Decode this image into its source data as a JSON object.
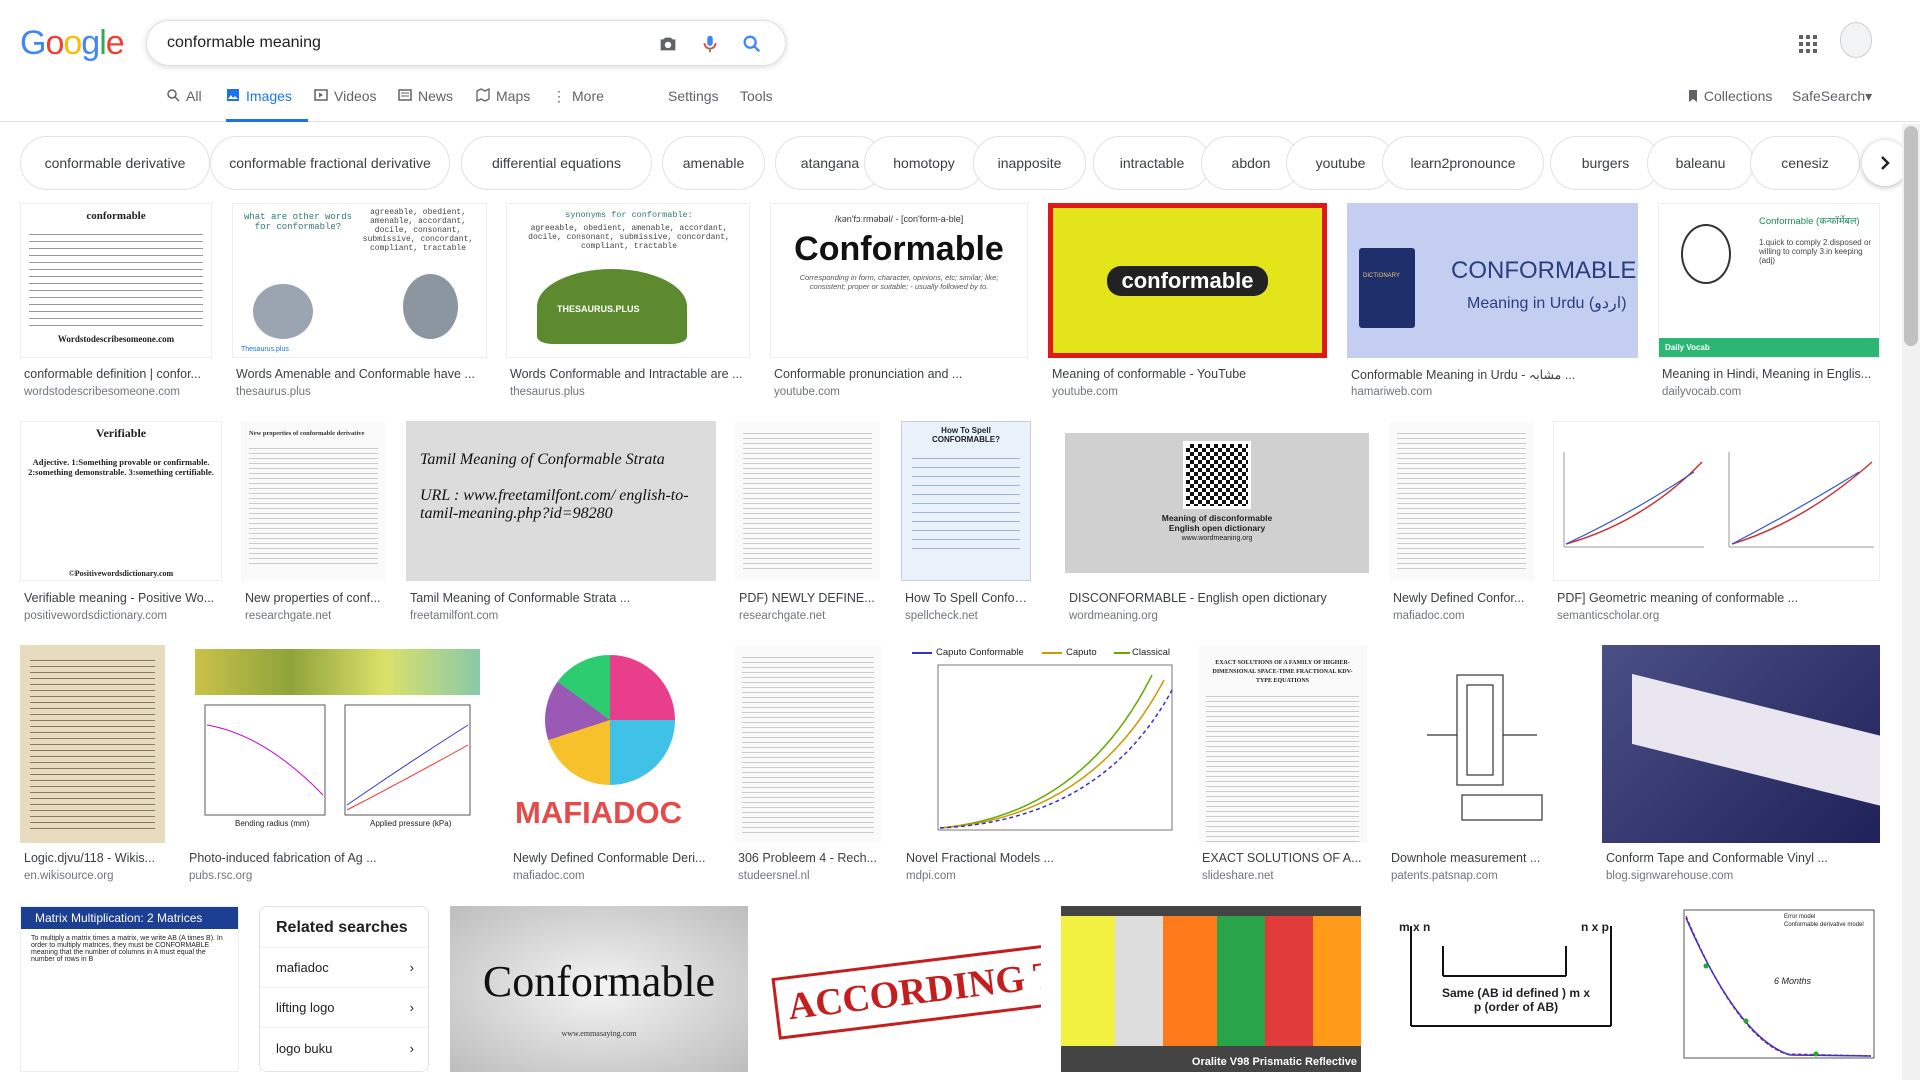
{
  "header": {
    "logo_letters": [
      "G",
      "o",
      "o",
      "g",
      "l",
      "e"
    ],
    "logo_colors": [
      "#4285F4",
      "#EA4335",
      "#FBBC05",
      "#4285F4",
      "#34A853",
      "#EA4335"
    ],
    "search_query": "conformable meaning"
  },
  "tabs": [
    {
      "label": "All",
      "icon": "search-icon"
    },
    {
      "label": "Images",
      "icon": "image-icon",
      "active": true
    },
    {
      "label": "Videos",
      "icon": "video-icon"
    },
    {
      "label": "News",
      "icon": "news-icon"
    },
    {
      "label": "Maps",
      "icon": "map-icon"
    },
    {
      "label": "More",
      "icon": "more-dots-icon"
    },
    {
      "label": "Settings"
    },
    {
      "label": "Tools"
    }
  ],
  "right_tools": {
    "collections": "Collections",
    "safesearch": "SafeSearch"
  },
  "chips": [
    "conformable derivative",
    "conformable fractional derivative",
    "differential equations",
    "amenable",
    "atangana",
    "homotopy",
    "inapposite",
    "intractable",
    "abdon",
    "youtube",
    "learn2pronounce",
    "burgers",
    "baleanu",
    "cenesiz"
  ],
  "results": [
    {
      "caption": "conformable definition | confor...",
      "source": "wordstodescribesomeone.com",
      "img_text": "conformable",
      "img_foot": "Wordstodescribesomeone.com"
    },
    {
      "caption": "Words Amenable and Conformable have ...",
      "source": "thesaurus.plus",
      "img_text": "what are other words for conformable?",
      "img_text2": "agreeable, obedient, amenable, accordant, docile, consonant, submissive, concordant, compliant, tractable",
      "img_foot": "Thesaurus.plus"
    },
    {
      "caption": "Words Conformable and Intractable are ...",
      "source": "thesaurus.plus",
      "img_text": "synonyms for conformable:",
      "img_text2": "agreeable, obedient, amenable, accordant, docile, consonant, submissive, concordant, compliant, tractable",
      "img_foot": "THESAURUS.PLUS"
    },
    {
      "caption": "Conformable pronunciation and ...",
      "source": "youtube.com",
      "img_text": "Conformable",
      "img_text2": "/kən'fɔːrməbəl/ - [con'form-a-ble]",
      "img_foot": "Corresponding in form, character, opinions, etc; similar; like; consistent; proper or suitable; - usually followed by to."
    },
    {
      "caption": "Meaning of conformable - YouTube",
      "source": "youtube.com",
      "img_text": "conformable"
    },
    {
      "caption": "Conformable Meaning in Urdu - مشابہ ...",
      "source": "hamariweb.com",
      "img_text": "CONFORMABLE",
      "img_text2": "Meaning in Urdu (اردو)",
      "img_foot": "DICTIONARY"
    },
    {
      "caption": "Meaning in Hindi, Meaning in Englis...",
      "source": "dailyvocab.com",
      "img_text": "Conformable (कन्फॉर्मेबल)",
      "img_text2": "1.quick to comply 2.disposed or willing to comply 3.in keeping (adj)",
      "img_foot": "Daily Vocab"
    },
    {
      "caption": "Verifiable meaning - Positive Wo...",
      "source": "positivewordsdictionary.com",
      "img_text": "Verifiable",
      "img_text2": "Adjective. 1:Something provable or confirmable. 2:something demonstrable. 3:something certifiable.",
      "img_foot": "©Positivewordsdictionary.com"
    },
    {
      "caption": "New properties of conf...",
      "source": "researchgate.net",
      "img_text": "New properties of conformable derivative"
    },
    {
      "caption": "Tamil Meaning of Conformable Strata ...",
      "source": "freetamilfont.com",
      "img_text": "Tamil Meaning of Conformable Strata",
      "img_text2": "URL : www.freetamilfont.com/ english-to-tamil-meaning.php?id=98280"
    },
    {
      "caption": "PDF) NEWLY DEFINE...",
      "source": "researchgate.net"
    },
    {
      "caption": "How To Spell Conform...",
      "source": "spellcheck.net",
      "img_text": "How To Spell CONFORMABLE?"
    },
    {
      "caption": "DISCONFORMABLE - English open dictionary",
      "source": "wordmeaning.org",
      "img_text": "Meaning of disconformable English open dictionary",
      "img_foot": "www.wordmeaning.org"
    },
    {
      "caption": "Newly Defined Confor...",
      "source": "mafiadoc.com"
    },
    {
      "caption": "PDF] Geometric meaning of conformable ...",
      "source": "semanticscholar.org"
    },
    {
      "caption": "Logic.djvu/118 - Wikis...",
      "source": "en.wikisource.org"
    },
    {
      "caption": "Photo-induced fabrication of Ag ...",
      "source": "pubs.rsc.org",
      "img_text": "Bending radius (mm)",
      "img_text2": "Applied pressure (kPa)"
    },
    {
      "caption": "Newly Defined Conformable Deri...",
      "source": "mafiadoc.com",
      "img_text": "MAFIADOC"
    },
    {
      "caption": "306 Probleem 4 - Rech...",
      "source": "studeersnel.nl"
    },
    {
      "caption": "Novel Fractional Models ...",
      "source": "mdpi.com",
      "img_text": "Caputo Conformable",
      "img_text2": "Caputo",
      "img_foot": "Classical"
    },
    {
      "caption": "EXACT SOLUTIONS OF A...",
      "source": "slideshare.net",
      "img_text": "EXACT SOLUTIONS OF A FAMILY OF HIGHER-DIMENSIONAL SPACE-TIME FRACTIONAL KDV-TYPE EQUATIONS"
    },
    {
      "caption": "Downhole measurement ...",
      "source": "patents.patsnap.com"
    },
    {
      "caption": "Conform Tape and Conformable Vinyl ...",
      "source": "blog.signwarehouse.com"
    },
    {
      "img_text": "Matrix Multiplication: 2 Matrices",
      "img_text2": "To multiply a matrix times a matrix, we write AB (A times B). In order to multiply matrices, they must be CONFORMABLE meaning that the number of columns in A must equal the number of rows in B"
    },
    {
      "img_text": "Conformable",
      "img_foot": "www.emmasaying.com"
    },
    {
      "img_text": "ACCORDING TO"
    },
    {
      "img_text": "Oralite V98 Prismatic Reflective"
    },
    {
      "img_text": "Same (AB id defined ) m x p (order of AB)",
      "img_text2": "m x n",
      "img_foot": "n x p"
    },
    {
      "img_text": "6 Months",
      "img_text2": "Error model",
      "img_foot": "Conformable derivative model"
    }
  ],
  "related": {
    "title": "Related searches",
    "items": [
      "mafiadoc",
      "lifting logo",
      "logo buku"
    ]
  }
}
